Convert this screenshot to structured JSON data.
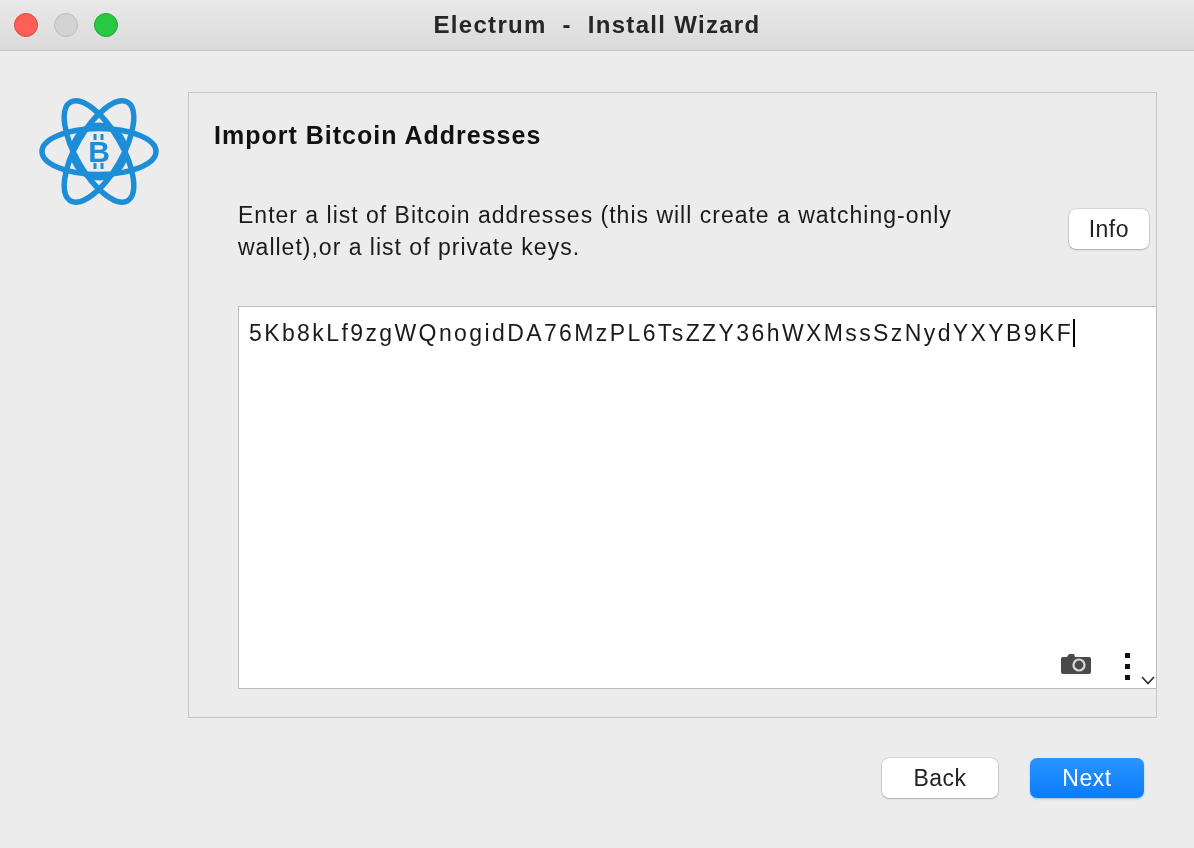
{
  "window": {
    "title": "Electrum  -  Install Wizard",
    "traffic_lights": [
      {
        "kind": "close",
        "disabled": false
      },
      {
        "kind": "minimize",
        "disabled": true
      },
      {
        "kind": "zoom",
        "disabled": false
      }
    ]
  },
  "logo": {
    "symbol": "B"
  },
  "panel": {
    "title": "Import Bitcoin Addresses",
    "description": "Enter a list of Bitcoin addresses (this will create a watching-only wallet),or a list of private keys.",
    "info_button": "Info",
    "text_area": {
      "value": "5Kb8kLf9zgWQnogidDA76MzPL6TsZZY36hWXMssSzNydYXYB9KF",
      "focused": true
    }
  },
  "buttons": [
    {
      "label": "Back",
      "default": false
    },
    {
      "label": "Next",
      "default": true
    }
  ]
}
